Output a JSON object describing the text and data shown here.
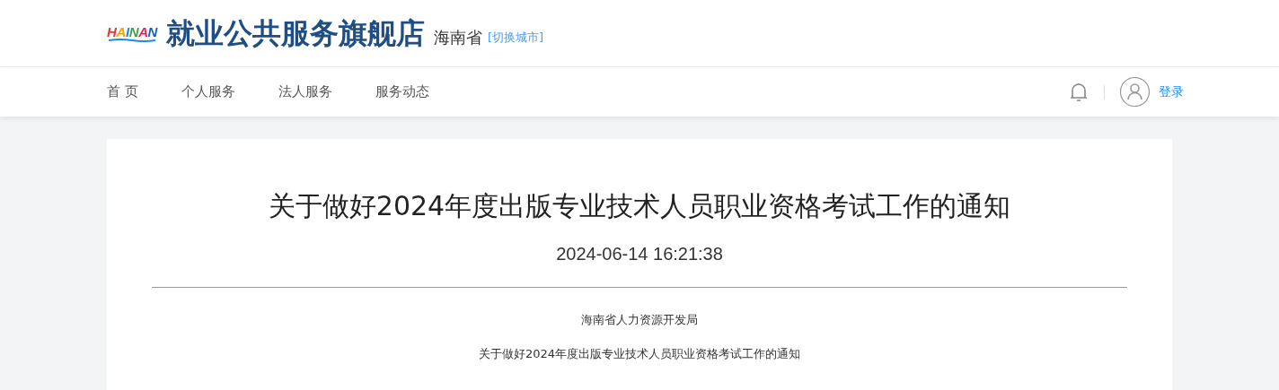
{
  "header": {
    "logo_text": "HAINAN",
    "site_title": "就业公共服务旗舰店",
    "province": "海南省",
    "switch_city": "[切换城市]"
  },
  "nav": {
    "items": [
      {
        "label": "首 页"
      },
      {
        "label": "个人服务"
      },
      {
        "label": "法人服务"
      },
      {
        "label": "服务动态"
      }
    ],
    "login": "登录"
  },
  "article": {
    "title": "关于做好2024年度出版专业技术人员职业资格考试工作的通知",
    "date": "2024-06-14 16:21:38",
    "paragraphs": [
      "海南省人力资源开发局",
      "关于做好2024年度出版专业技术人员职业资格考试工作的通知"
    ]
  }
}
